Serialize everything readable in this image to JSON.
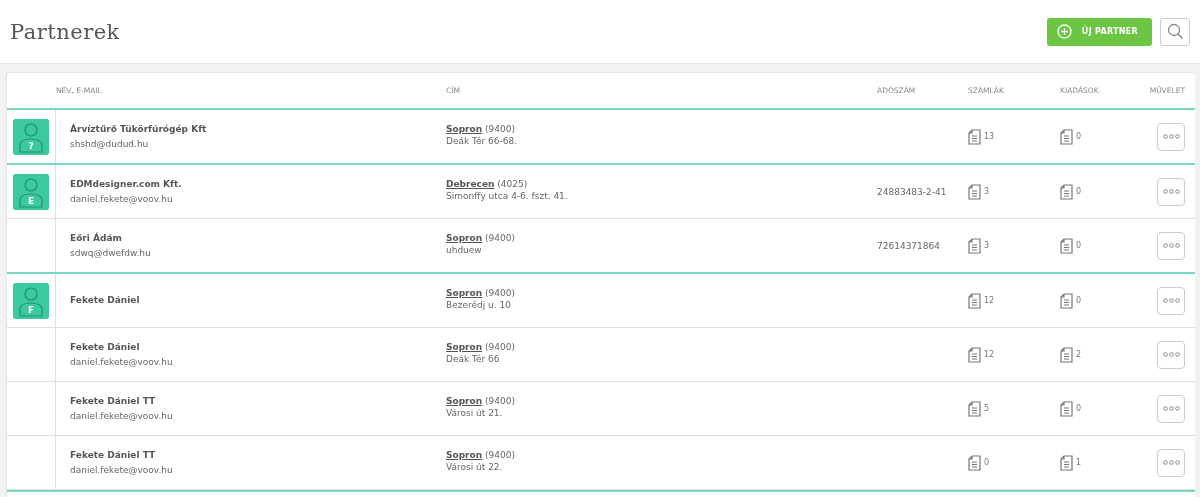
{
  "header": {
    "title": "Partnerek",
    "new_button": {
      "label": "ÚJ PARTNER"
    }
  },
  "table": {
    "columns": [
      "NÉV, E-MAIL",
      "CÍM",
      "ADÓSZÁM",
      "SZÁMLÁK",
      "KIADÁSOK",
      "MŰVELET"
    ],
    "rows": [
      {
        "avatar": "?",
        "name": "Árvíztűrő Tükörfúrógép Kft",
        "email": "shshd@dudud.hu",
        "city": "Sopron",
        "zip": "(9400)",
        "street": "Deák Tér 66-68.",
        "tax_number": "",
        "invoices": "13",
        "expenses": "0"
      },
      {
        "avatar": "E",
        "name": "EDMdesigner.com Kft.",
        "email": "daniel.fekete@voov.hu",
        "city": "Debrecen",
        "zip": "(4025)",
        "street": "Simonffy utca 4-6. fszt. 41.",
        "tax_number": "24883483-2-41",
        "invoices": "3",
        "expenses": "0"
      },
      {
        "name": "Eőri Ádám",
        "email": "sdwq@dwefdw.hu",
        "city": "Sopron",
        "zip": "(9400)",
        "street": "uhduew",
        "tax_number": "72614371864",
        "invoices": "3",
        "expenses": "0"
      },
      {
        "avatar": "F",
        "name": "Fekete Dániel",
        "email": "",
        "city": "Sopron",
        "zip": "(9400)",
        "street": "Bezerédj u. 10",
        "tax_number": "",
        "invoices": "12",
        "expenses": "0"
      },
      {
        "name": "Fekete Dániel",
        "email": "daniel.fekete@voov.hu",
        "city": "Sopron",
        "zip": "(9400)",
        "street": "Deák Tér 66",
        "tax_number": "",
        "invoices": "12",
        "expenses": "2"
      },
      {
        "name": "Fekete Dániel TT",
        "email": "daniel.fekete@voov.hu",
        "city": "Sopron",
        "zip": "(9400)",
        "street": "Városi út 21.",
        "tax_number": "",
        "invoices": "5",
        "expenses": "0"
      },
      {
        "name": "Fekete Dániel TT",
        "email": "daniel.fekete@voov.hu",
        "city": "Sopron",
        "zip": "(9400)",
        "street": "Városi út 22.",
        "tax_number": "",
        "invoices": "0",
        "expenses": "1"
      }
    ]
  }
}
